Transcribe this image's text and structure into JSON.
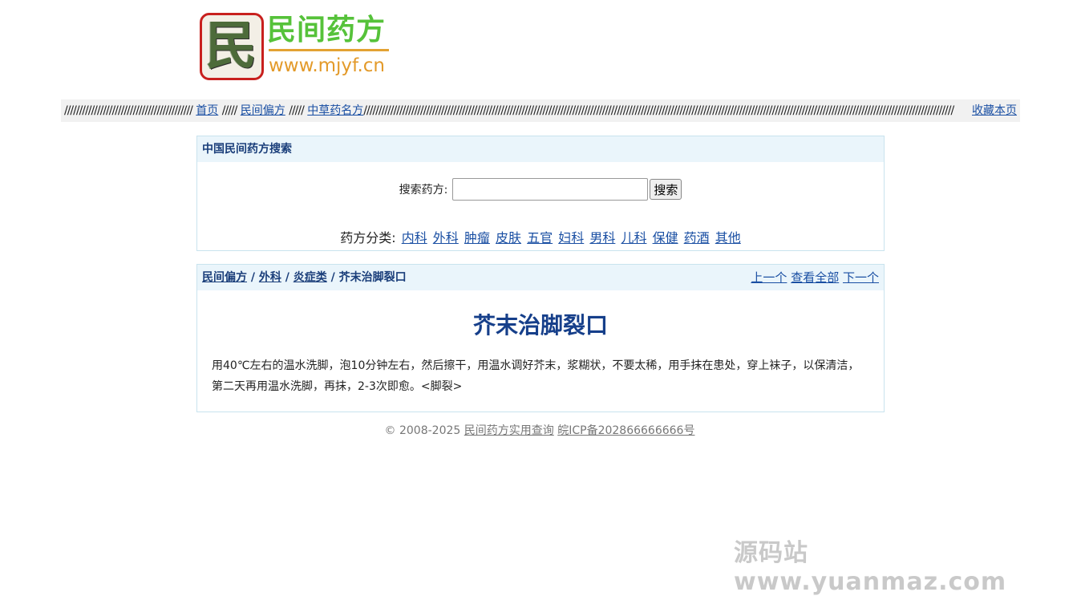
{
  "logo": {
    "char": "民",
    "name": "民间药方",
    "url": "www.mjyf.cn",
    "colors": {
      "name": "#56c23a",
      "url": "#e39a2a",
      "border": "#c8201e"
    }
  },
  "nav": {
    "sep_left": "///////////////////////////////////////////",
    "sep_mid": "/////",
    "sep_right": "//////////////////////////////////////////////////////////////////////////////////////////////////////////////////////////////////////////////////////////////////////////////////////////////////////",
    "home": "首页",
    "folk": "民间偏方",
    "herbal": "中草药名方",
    "bookmark": "收藏本页"
  },
  "search": {
    "header": "中国民间药方搜索",
    "label": "搜索药方:",
    "placeholder": "",
    "value": "",
    "button": "搜索",
    "cat_label": "药方分类:",
    "categories": [
      "内科",
      "外科",
      "肿瘤",
      "皮肤",
      "五官",
      "妇科",
      "男科",
      "儿科",
      "保健",
      "药酒",
      "其他"
    ]
  },
  "content": {
    "breadcrumb": {
      "c1": "民间偏方",
      "c2": "外科",
      "c3": "炎症类",
      "current": "芥末治脚裂口",
      "sep": "/"
    },
    "pager": {
      "prev": "上一个",
      "all": "查看全部",
      "next": "下一个"
    },
    "title": "芥末治脚裂口",
    "body": "用40℃左右的温水洗脚，泡10分钟左右，然后擦干，用温水调好芥末，浆糊状，不要太稀，用手抹在患处，穿上袜子，以保清洁，第二天再用温水洗脚，再抹，2-3次即愈。<脚裂>"
  },
  "footer": {
    "copyright": "© 2008-2025",
    "site_link": "民间药方实用查询",
    "icp": "皖ICP备202866666666号"
  },
  "watermark": "源码站www.yuanmaz.com"
}
